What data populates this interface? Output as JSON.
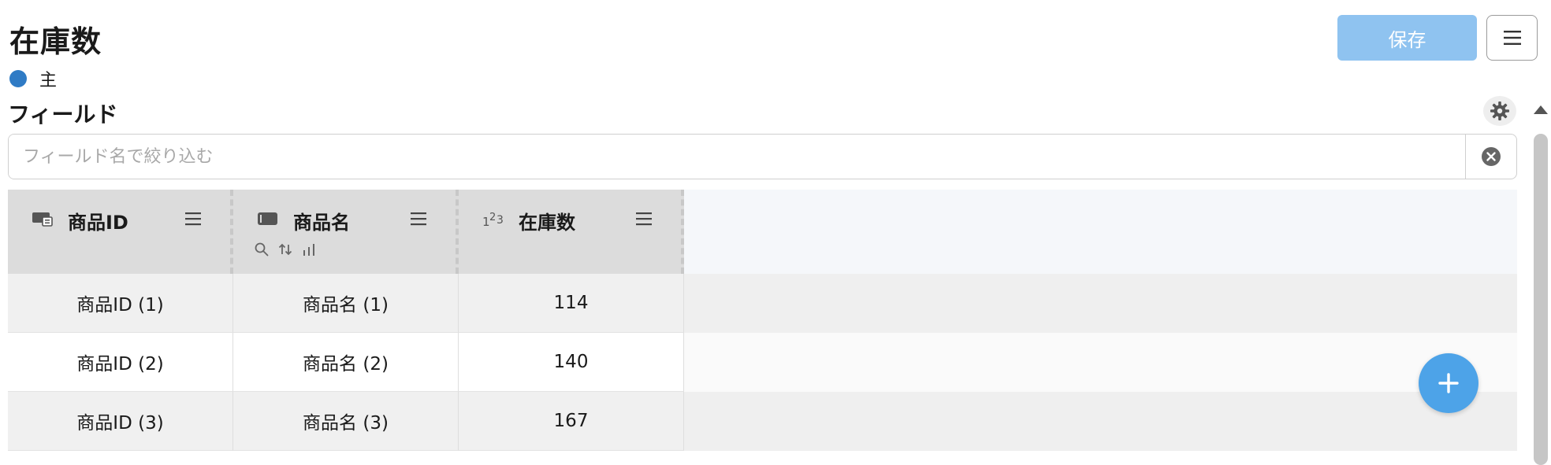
{
  "page": {
    "title": "在庫数"
  },
  "legend": {
    "label": "主",
    "color": "#2f7bc5"
  },
  "toolbar": {
    "save_label": "保存"
  },
  "fields": {
    "title": "フィールド",
    "filter_placeholder": "フィールド名で絞り込む",
    "filter_value": ""
  },
  "grid": {
    "columns": [
      {
        "label": "商品ID",
        "icon": "id-card-icon"
      },
      {
        "label": "商品名",
        "icon": "text-field-icon"
      },
      {
        "label": "在庫数",
        "icon": "number-icon"
      }
    ],
    "rows": [
      [
        "商品ID (1)",
        "商品名 (1)",
        "114"
      ],
      [
        "商品ID (2)",
        "商品名 (2)",
        "140"
      ],
      [
        "商品ID (3)",
        "商品名 (3)",
        "167"
      ]
    ]
  },
  "colors": {
    "accent": "#4da3e8",
    "save_disabled": "#8fc3f0"
  }
}
